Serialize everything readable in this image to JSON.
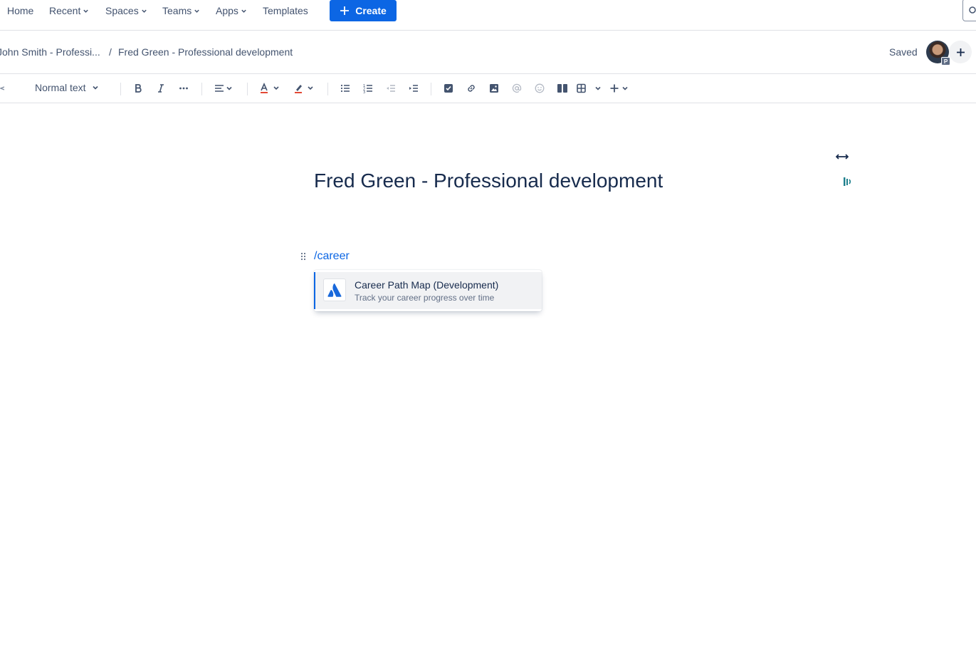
{
  "nav": {
    "home": "Home",
    "recent": "Recent",
    "spaces": "Spaces",
    "teams": "Teams",
    "apps": "Apps",
    "templates": "Templates",
    "create": "Create"
  },
  "breadcrumb": {
    "parent": "John Smith - Professi...",
    "separator": "/",
    "current": "Fred Green - Professional development"
  },
  "status": {
    "saved": "Saved",
    "avatar_badge": "P"
  },
  "toolbar": {
    "text_style": "Normal text"
  },
  "editor": {
    "title": "Fred Green - Professional development",
    "slash_command": "/career"
  },
  "suggestions": [
    {
      "title": "Career Path Map (Development)",
      "description": "Track your career progress over time",
      "icon": "atlassian-logo-icon"
    }
  ],
  "colors": {
    "accent": "#0c66e4",
    "text": "#172b4d",
    "subtle": "#44546f",
    "border": "#dfe1e6"
  }
}
